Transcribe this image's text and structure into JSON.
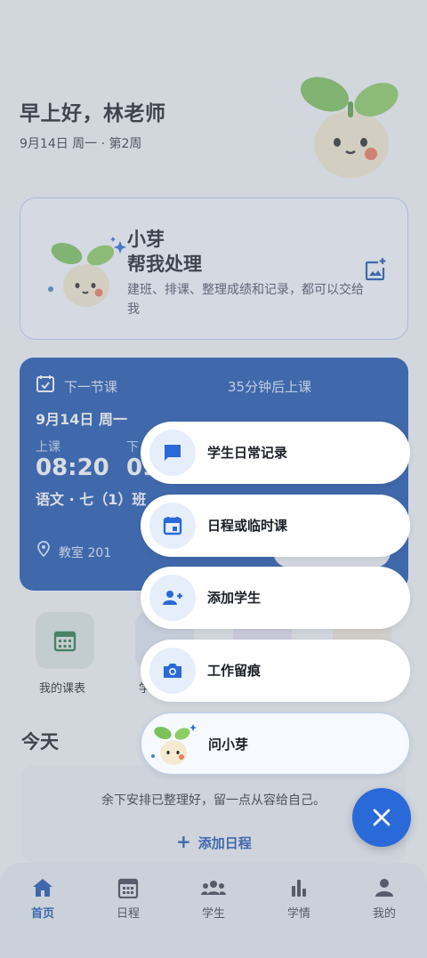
{
  "header": {
    "greeting": "早上好，林老师",
    "date_line": "9月14日 周一 · 第2周"
  },
  "ai_card": {
    "name": "小芽",
    "subtitle": "帮我处理",
    "description": "建班、排课、整理成绩和记录，都可以交给我"
  },
  "class_card": {
    "next_label": "下一节课",
    "countdown": "35分钟后上课",
    "date": "9月14日  周一",
    "start_label": "上课",
    "start_time": "08:20",
    "end_label": "下",
    "end_time": "09",
    "subject": "语文 · 七（1）班",
    "room": "教室 201"
  },
  "quick": {
    "schedule_label": "我的课表",
    "second_label": "学"
  },
  "today": {
    "title": "今天",
    "message": "余下安排已整理好，留一点从容给自己。",
    "add_label": "添加日程"
  },
  "speed_dial": [
    {
      "label": "学生日常记录",
      "icon": "chat-icon"
    },
    {
      "label": "日程或临时课",
      "icon": "calendar-event-icon"
    },
    {
      "label": "添加学生",
      "icon": "person-add-icon"
    },
    {
      "label": "工作留痕",
      "icon": "camera-icon"
    },
    {
      "label": "问小芽",
      "icon": "mascot-icon"
    }
  ],
  "bottom_nav": [
    {
      "label": "首页",
      "icon": "home-icon",
      "active": true
    },
    {
      "label": "日程",
      "icon": "calendar-icon",
      "active": false
    },
    {
      "label": "学生",
      "icon": "group-icon",
      "active": false
    },
    {
      "label": "学情",
      "icon": "bar-chart-icon",
      "active": false
    },
    {
      "label": "我的",
      "icon": "person-icon",
      "active": false
    }
  ],
  "colors": {
    "primary": "#1d55b0",
    "accent": "#2a6ad8",
    "fab_icon": "#ffffff"
  }
}
